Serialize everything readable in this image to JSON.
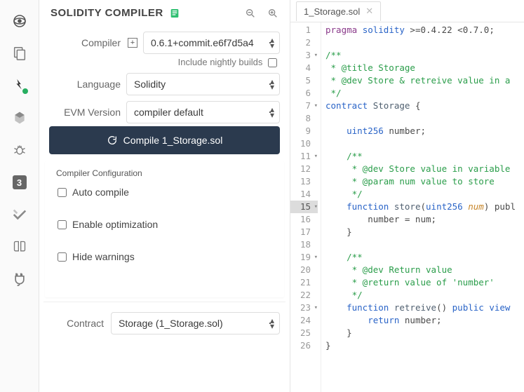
{
  "header": {
    "title": "SOLIDITY COMPILER"
  },
  "compiler": {
    "label": "Compiler",
    "selected": "0.6.1+commit.e6f7d5a4",
    "nightly_label": "Include nightly builds"
  },
  "language": {
    "label": "Language",
    "selected": "Solidity"
  },
  "evm": {
    "label": "EVM Version",
    "selected": "compiler default"
  },
  "compile_button": "Compile 1_Storage.sol",
  "config": {
    "heading": "Compiler Configuration",
    "auto_compile": "Auto compile",
    "enable_opt": "Enable optimization",
    "hide_warn": "Hide warnings"
  },
  "contract": {
    "label": "Contract",
    "selected": "Storage (1_Storage.sol)"
  },
  "tab": {
    "name": "1_Storage.sol"
  },
  "iconbar": {
    "badge_num": "3"
  },
  "code": {
    "lines": [
      {
        "n": 1,
        "html": "<span class='k-pragma'>pragma</span> <span class='k-key'>solidity</span> &gt;=0.4.22 &lt;0.7.0;"
      },
      {
        "n": 2,
        "html": ""
      },
      {
        "n": 3,
        "html": "<span class='k-comment'>/**</span>",
        "fold": true
      },
      {
        "n": 4,
        "html": "<span class='k-comment'> * @title Storage</span>"
      },
      {
        "n": 5,
        "html": "<span class='k-comment'> * @dev Store &amp; retreive value in a </span>"
      },
      {
        "n": 6,
        "html": "<span class='k-comment'> */</span>"
      },
      {
        "n": 7,
        "html": "<span class='k-key'>contract</span> <span class='k-name'>Storage</span> {",
        "fold": true
      },
      {
        "n": 8,
        "html": ""
      },
      {
        "n": 9,
        "html": "    <span class='k-type'>uint256</span> number;"
      },
      {
        "n": 10,
        "html": ""
      },
      {
        "n": 11,
        "html": "    <span class='k-comment'>/**</span>",
        "fold": true
      },
      {
        "n": 12,
        "html": "    <span class='k-comment'> * @dev Store value in variable</span>"
      },
      {
        "n": 13,
        "html": "    <span class='k-comment'> * @param num value to store</span>"
      },
      {
        "n": 14,
        "html": "    <span class='k-comment'> */</span>"
      },
      {
        "n": 15,
        "html": "    <span class='k-key'>function</span> <span class='k-name'>store</span>(<span class='k-type'>uint256</span> <span class='k-param'>num</span>) publ",
        "fold": true,
        "hl": true
      },
      {
        "n": 16,
        "html": "        number = num;"
      },
      {
        "n": 17,
        "html": "    }"
      },
      {
        "n": 18,
        "html": ""
      },
      {
        "n": 19,
        "html": "    <span class='k-comment'>/**</span>",
        "fold": true
      },
      {
        "n": 20,
        "html": "    <span class='k-comment'> * @dev Return value </span>"
      },
      {
        "n": 21,
        "html": "    <span class='k-comment'> * @return value of 'number'</span>"
      },
      {
        "n": 22,
        "html": "    <span class='k-comment'> */</span>"
      },
      {
        "n": 23,
        "html": "    <span class='k-key'>function</span> <span class='k-name'>retreive</span>() <span class='k-key'>public</span> <span class='k-key'>view</span> ",
        "fold": true
      },
      {
        "n": 24,
        "html": "        <span class='k-key'>return</span> number;"
      },
      {
        "n": 25,
        "html": "    }"
      },
      {
        "n": 26,
        "html": "}"
      }
    ]
  }
}
